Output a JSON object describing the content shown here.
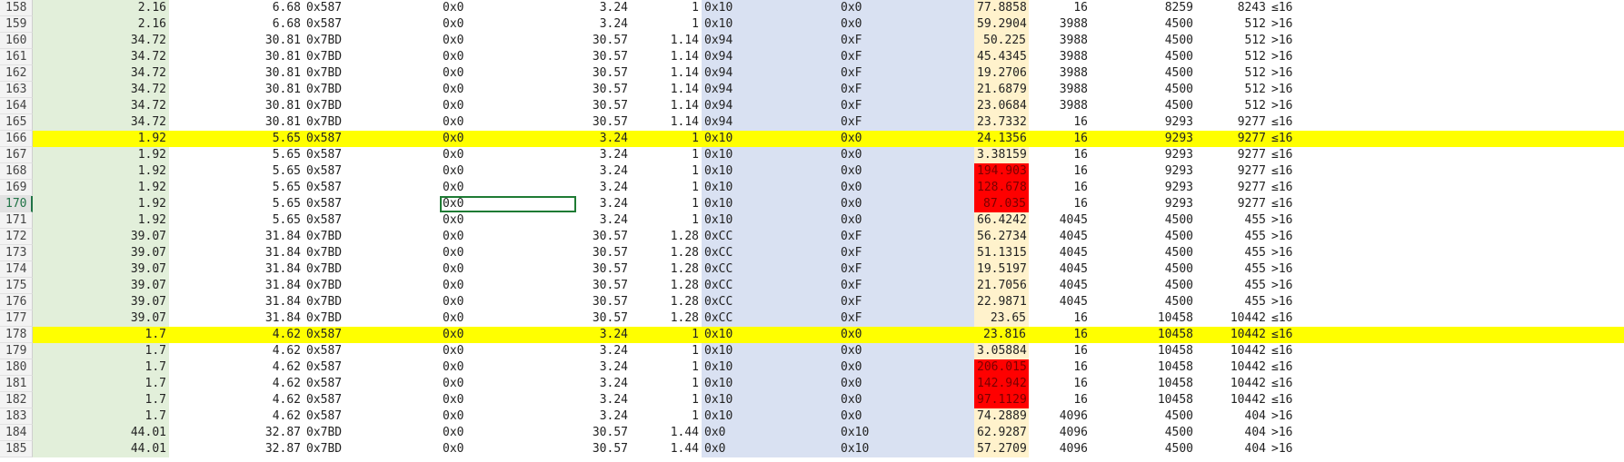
{
  "colors": {
    "row_highlight": "#ffff00",
    "alert_cell": "#ff0000",
    "column_a_fill": "#e2efda",
    "column_h_fill": "#d9e1f2",
    "column_j_fill": "#fff2cc",
    "selection_border": "#1e7b34"
  },
  "selected_cell": {
    "row": "170",
    "column": "D"
  },
  "rows": [
    {
      "n": "158",
      "c": [
        "2.16",
        "6.68",
        "0x587",
        "0x0",
        "3.24",
        "1",
        "0x10",
        "0x0",
        "77.8858",
        "16",
        "8259",
        "8243",
        "≤16"
      ]
    },
    {
      "n": "159",
      "c": [
        "2.16",
        "6.68",
        "0x587",
        "0x0",
        "3.24",
        "1",
        "0x10",
        "0x0",
        "59.2904",
        "3988",
        "4500",
        "512",
        ">16"
      ]
    },
    {
      "n": "160",
      "c": [
        "34.72",
        "30.81",
        "0x7BD",
        "0x0",
        "30.57",
        "1.14",
        "0x94",
        "0xF",
        "50.225",
        "3988",
        "4500",
        "512",
        ">16"
      ]
    },
    {
      "n": "161",
      "c": [
        "34.72",
        "30.81",
        "0x7BD",
        "0x0",
        "30.57",
        "1.14",
        "0x94",
        "0xF",
        "45.4345",
        "3988",
        "4500",
        "512",
        ">16"
      ]
    },
    {
      "n": "162",
      "c": [
        "34.72",
        "30.81",
        "0x7BD",
        "0x0",
        "30.57",
        "1.14",
        "0x94",
        "0xF",
        "19.2706",
        "3988",
        "4500",
        "512",
        ">16"
      ]
    },
    {
      "n": "163",
      "c": [
        "34.72",
        "30.81",
        "0x7BD",
        "0x0",
        "30.57",
        "1.14",
        "0x94",
        "0xF",
        "21.6879",
        "3988",
        "4500",
        "512",
        ">16"
      ]
    },
    {
      "n": "164",
      "c": [
        "34.72",
        "30.81",
        "0x7BD",
        "0x0",
        "30.57",
        "1.14",
        "0x94",
        "0xF",
        "23.0684",
        "3988",
        "4500",
        "512",
        ">16"
      ]
    },
    {
      "n": "165",
      "c": [
        "34.72",
        "30.81",
        "0x7BD",
        "0x0",
        "30.57",
        "1.14",
        "0x94",
        "0xF",
        "23.7332",
        "16",
        "9293",
        "9277",
        "≤16"
      ]
    },
    {
      "n": "166",
      "c": [
        "1.92",
        "5.65",
        "0x587",
        "0x0",
        "3.24",
        "1",
        "0x10",
        "0x0",
        "24.1356",
        "16",
        "9293",
        "9277",
        "≤16"
      ],
      "highlight": true
    },
    {
      "n": "167",
      "c": [
        "1.92",
        "5.65",
        "0x587",
        "0x0",
        "3.24",
        "1",
        "0x10",
        "0x0",
        "3.38159",
        "16",
        "9293",
        "9277",
        "≤16"
      ]
    },
    {
      "n": "168",
      "c": [
        "1.92",
        "5.65",
        "0x587",
        "0x0",
        "3.24",
        "1",
        "0x10",
        "0x0",
        "194.903",
        "16",
        "9293",
        "9277",
        "≤16"
      ],
      "alert": true
    },
    {
      "n": "169",
      "c": [
        "1.92",
        "5.65",
        "0x587",
        "0x0",
        "3.24",
        "1",
        "0x10",
        "0x0",
        "128.678",
        "16",
        "9293",
        "9277",
        "≤16"
      ],
      "alert": true
    },
    {
      "n": "170",
      "c": [
        "1.92",
        "5.65",
        "0x587",
        "0x0",
        "3.24",
        "1",
        "0x10",
        "0x0",
        "87.035",
        "16",
        "9293",
        "9277",
        "≤16"
      ],
      "alert": true,
      "active": true
    },
    {
      "n": "171",
      "c": [
        "1.92",
        "5.65",
        "0x587",
        "0x0",
        "3.24",
        "1",
        "0x10",
        "0x0",
        "66.4242",
        "4045",
        "4500",
        "455",
        ">16"
      ]
    },
    {
      "n": "172",
      "c": [
        "39.07",
        "31.84",
        "0x7BD",
        "0x0",
        "30.57",
        "1.28",
        "0xCC",
        "0xF",
        "56.2734",
        "4045",
        "4500",
        "455",
        ">16"
      ]
    },
    {
      "n": "173",
      "c": [
        "39.07",
        "31.84",
        "0x7BD",
        "0x0",
        "30.57",
        "1.28",
        "0xCC",
        "0xF",
        "51.1315",
        "4045",
        "4500",
        "455",
        ">16"
      ]
    },
    {
      "n": "174",
      "c": [
        "39.07",
        "31.84",
        "0x7BD",
        "0x0",
        "30.57",
        "1.28",
        "0xCC",
        "0xF",
        "19.5197",
        "4045",
        "4500",
        "455",
        ">16"
      ]
    },
    {
      "n": "175",
      "c": [
        "39.07",
        "31.84",
        "0x7BD",
        "0x0",
        "30.57",
        "1.28",
        "0xCC",
        "0xF",
        "21.7056",
        "4045",
        "4500",
        "455",
        ">16"
      ]
    },
    {
      "n": "176",
      "c": [
        "39.07",
        "31.84",
        "0x7BD",
        "0x0",
        "30.57",
        "1.28",
        "0xCC",
        "0xF",
        "22.9871",
        "4045",
        "4500",
        "455",
        ">16"
      ]
    },
    {
      "n": "177",
      "c": [
        "39.07",
        "31.84",
        "0x7BD",
        "0x0",
        "30.57",
        "1.28",
        "0xCC",
        "0xF",
        "23.65",
        "16",
        "10458",
        "10442",
        "≤16"
      ]
    },
    {
      "n": "178",
      "c": [
        "1.7",
        "4.62",
        "0x587",
        "0x0",
        "3.24",
        "1",
        "0x10",
        "0x0",
        "23.816",
        "16",
        "10458",
        "10442",
        "≤16"
      ],
      "highlight": true
    },
    {
      "n": "179",
      "c": [
        "1.7",
        "4.62",
        "0x587",
        "0x0",
        "3.24",
        "1",
        "0x10",
        "0x0",
        "3.05884",
        "16",
        "10458",
        "10442",
        "≤16"
      ]
    },
    {
      "n": "180",
      "c": [
        "1.7",
        "4.62",
        "0x587",
        "0x0",
        "3.24",
        "1",
        "0x10",
        "0x0",
        "206.015",
        "16",
        "10458",
        "10442",
        "≤16"
      ],
      "alert": true
    },
    {
      "n": "181",
      "c": [
        "1.7",
        "4.62",
        "0x587",
        "0x0",
        "3.24",
        "1",
        "0x10",
        "0x0",
        "142.942",
        "16",
        "10458",
        "10442",
        "≤16"
      ],
      "alert": true
    },
    {
      "n": "182",
      "c": [
        "1.7",
        "4.62",
        "0x587",
        "0x0",
        "3.24",
        "1",
        "0x10",
        "0x0",
        "97.1129",
        "16",
        "10458",
        "10442",
        "≤16"
      ],
      "alert": true
    },
    {
      "n": "183",
      "c": [
        "1.7",
        "4.62",
        "0x587",
        "0x0",
        "3.24",
        "1",
        "0x10",
        "0x0",
        "74.2889",
        "4096",
        "4500",
        "404",
        ">16"
      ]
    },
    {
      "n": "184",
      "c": [
        "44.01",
        "32.87",
        "0x7BD",
        "0x0",
        "30.57",
        "1.44",
        "0x0",
        "0x10",
        "62.9287",
        "4096",
        "4500",
        "404",
        ">16"
      ]
    },
    {
      "n": "185",
      "c": [
        "44.01",
        "32.87",
        "0x7BD",
        "0x0",
        "30.57",
        "1.44",
        "0x0",
        "0x10",
        "57.2709",
        "4096",
        "4500",
        "404",
        ">16"
      ]
    }
  ]
}
